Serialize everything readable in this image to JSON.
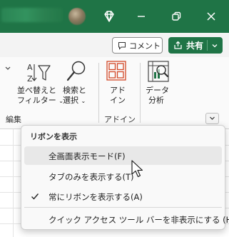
{
  "titlebar": {
    "title_text": "",
    "bg_color": "#1f7446"
  },
  "actions": {
    "comment_label": "コメント",
    "share_label": "共有"
  },
  "ribbon": {
    "sort_filter_line1": "並べ替えと",
    "sort_filter_line2": "フィルター",
    "find_select_line1": "検索と",
    "find_select_line2": "選択",
    "addin_line1": "アド",
    "addin_line2": "イン",
    "data_analysis_line1": "データ",
    "data_analysis_line2": "分析",
    "group_edit": "編集",
    "group_addin": "アドイン"
  },
  "menu": {
    "header": "リボンを表示",
    "items": [
      {
        "label": "全画面表示モード(F)",
        "checked": false,
        "hover": true
      },
      {
        "label": "タブのみを表示する(T)",
        "checked": false,
        "hover": false
      },
      {
        "label": "常にリボンを表示する(A)",
        "checked": true,
        "hover": false
      },
      {
        "label": "クイック アクセス ツール バーを非表示にする (H)",
        "checked": false,
        "hover": false
      }
    ]
  },
  "colors": {
    "accent": "#1f7446",
    "addin_icon": "#d24726",
    "menu_hover": "#e8e8e8"
  }
}
